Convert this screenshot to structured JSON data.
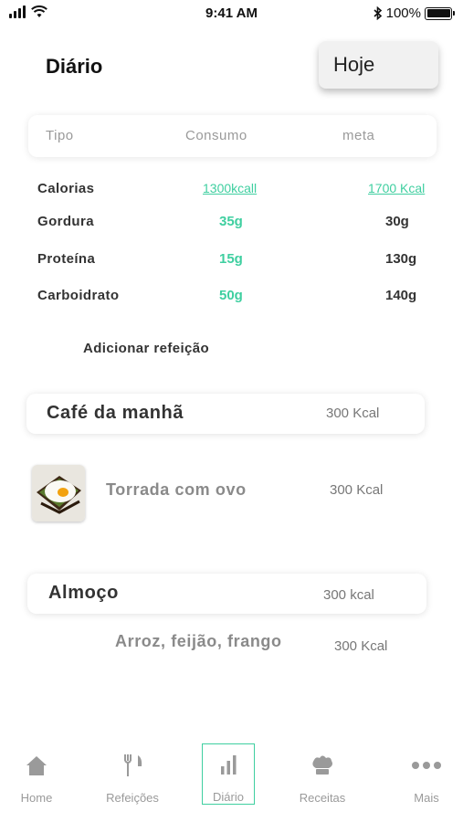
{
  "status_bar": {
    "time": "9:41 AM",
    "battery": "100%",
    "battery_level": 1.0
  },
  "header": {
    "title": "Diário",
    "date_selector": "Hoje"
  },
  "summary": {
    "columns": [
      "Tipo",
      "Consumo",
      "meta"
    ],
    "rows": [
      {
        "label": "Calorias",
        "consumed": "1300kcall",
        "goal": "1700 Kcal"
      },
      {
        "label": "Gordura",
        "consumed": "35g",
        "goal": "30g"
      },
      {
        "label": "Proteína",
        "consumed": "15g",
        "goal": "130g"
      },
      {
        "label": "Carboidrato",
        "consumed": "50g",
        "goal": "140g"
      }
    ]
  },
  "add_meal_label": "Adicionar refeição",
  "meals": [
    {
      "name": "Café da manhã",
      "kcal": "300 Kcal",
      "items": [
        {
          "name": "Torrada com ovo",
          "kcal": "300 Kcal",
          "icon": "toast-egg-photo"
        }
      ]
    },
    {
      "name": "Almoço",
      "kcal": "300 kcal",
      "items": [
        {
          "name": "Arroz, feijão, frango",
          "kcal": "300 Kcal"
        }
      ]
    }
  ],
  "tabs": [
    {
      "label": "Home",
      "icon": "home-icon"
    },
    {
      "label": "Refeições",
      "icon": "fork-knife-icon"
    },
    {
      "label": "Diário",
      "icon": "bar-chart-icon",
      "active": true
    },
    {
      "label": "Receitas",
      "icon": "chef-hat-icon"
    },
    {
      "label": "Mais",
      "icon": "more-dots-icon"
    }
  ],
  "colors": {
    "accent": "#3fcfa0",
    "text": "#333333",
    "muted": "#9a9a9a"
  }
}
